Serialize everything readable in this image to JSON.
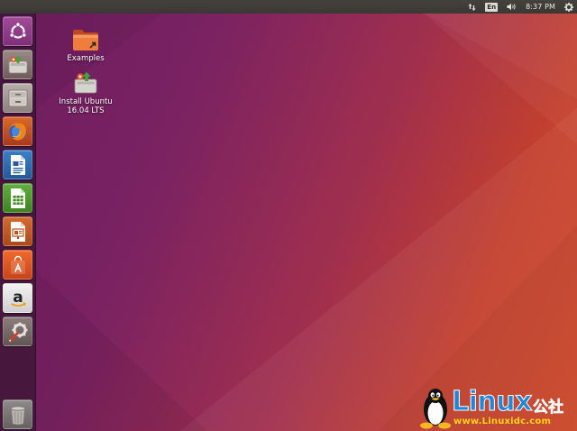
{
  "top_panel": {
    "keyboard_layout": "En",
    "clock": "8:37 PM",
    "icons": [
      "network-arrows-icon",
      "keyboard-layout-indicator",
      "volume-icon",
      "gear-icon"
    ]
  },
  "launcher": {
    "items": [
      {
        "name": "ubuntu-dash",
        "icon": "ubuntu-logo-icon"
      },
      {
        "name": "install-ubuntu",
        "icon": "installer-icon"
      },
      {
        "name": "files",
        "icon": "file-cabinet-icon"
      },
      {
        "name": "firefox",
        "icon": "firefox-icon"
      },
      {
        "name": "libreoffice-writer",
        "icon": "writer-document-icon"
      },
      {
        "name": "libreoffice-calc",
        "icon": "calc-spreadsheet-icon"
      },
      {
        "name": "libreoffice-impress",
        "icon": "impress-presentation-icon"
      },
      {
        "name": "ubuntu-software",
        "icon": "shopping-bag-icon"
      },
      {
        "name": "amazon",
        "icon": "amazon-icon"
      },
      {
        "name": "system-settings",
        "icon": "wrench-gear-icon"
      },
      {
        "name": "trash",
        "icon": "trash-icon"
      }
    ]
  },
  "desktop": {
    "icons": [
      {
        "label": "Examples",
        "icon": "folder-icon"
      },
      {
        "label_line1": "Install Ubuntu",
        "label_line2": "16.04 LTS",
        "icon": "installer-icon"
      }
    ]
  },
  "watermark": {
    "brand": "Linux",
    "brand_cn": "公社",
    "url": "www.Linuxidc.com"
  },
  "colors": {
    "panel": "#3c3b37",
    "wallpaper_start": "#6e1d5f",
    "wallpaper_end": "#d44a2a",
    "ubuntu_orange": "#e95420",
    "watermark_blue": "#1f86d8",
    "watermark_yellow": "#ffd21a"
  }
}
